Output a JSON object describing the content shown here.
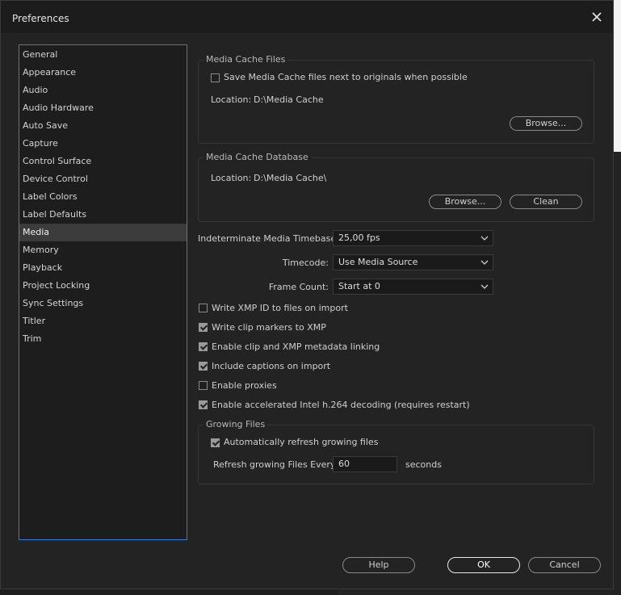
{
  "dialog": {
    "title": "Preferences"
  },
  "sidebar": {
    "items": [
      {
        "label": "General"
      },
      {
        "label": "Appearance"
      },
      {
        "label": "Audio"
      },
      {
        "label": "Audio Hardware"
      },
      {
        "label": "Auto Save"
      },
      {
        "label": "Capture"
      },
      {
        "label": "Control Surface"
      },
      {
        "label": "Device Control"
      },
      {
        "label": "Label Colors"
      },
      {
        "label": "Label Defaults"
      },
      {
        "label": "Media"
      },
      {
        "label": "Memory"
      },
      {
        "label": "Playback"
      },
      {
        "label": "Project Locking"
      },
      {
        "label": "Sync Settings"
      },
      {
        "label": "Titler"
      },
      {
        "label": "Trim"
      }
    ],
    "selected": "Media"
  },
  "media_cache_files": {
    "title": "Media Cache Files",
    "save_next_to_originals": {
      "label": "Save Media Cache files next to originals when possible",
      "checked": false
    },
    "location_label": "Location:",
    "location_value": "D:\\Media Cache",
    "browse_label": "Browse..."
  },
  "media_cache_database": {
    "title": "Media Cache Database",
    "location_label": "Location:",
    "location_value": "D:\\Media Cache\\",
    "browse_label": "Browse...",
    "clean_label": "Clean"
  },
  "settings": {
    "timebase_label": "Indeterminate Media Timebase:",
    "timebase_value": "25,00 fps",
    "timecode_label": "Timecode:",
    "timecode_value": "Use Media Source",
    "frame_count_label": "Frame Count:",
    "frame_count_value": "Start at 0"
  },
  "options": [
    {
      "label": "Write XMP ID to files on import",
      "checked": false
    },
    {
      "label": "Write clip markers to XMP",
      "checked": true
    },
    {
      "label": "Enable clip and XMP metadata linking",
      "checked": true
    },
    {
      "label": "Include captions on import",
      "checked": true
    },
    {
      "label": "Enable proxies",
      "checked": false
    },
    {
      "label": "Enable accelerated Intel h.264 decoding (requires restart)",
      "checked": true
    }
  ],
  "growing_files": {
    "title": "Growing Files",
    "auto_refresh": {
      "label": "Automatically refresh growing files",
      "checked": true
    },
    "refresh_label": "Refresh growing Files Every",
    "refresh_value": "60",
    "refresh_unit": "seconds"
  },
  "footer": {
    "help_label": "Help",
    "ok_label": "OK",
    "cancel_label": "Cancel"
  },
  "colors": {
    "accent": "#2d7fd4",
    "background": "#232323",
    "selected_item": "#3c3c3c"
  }
}
